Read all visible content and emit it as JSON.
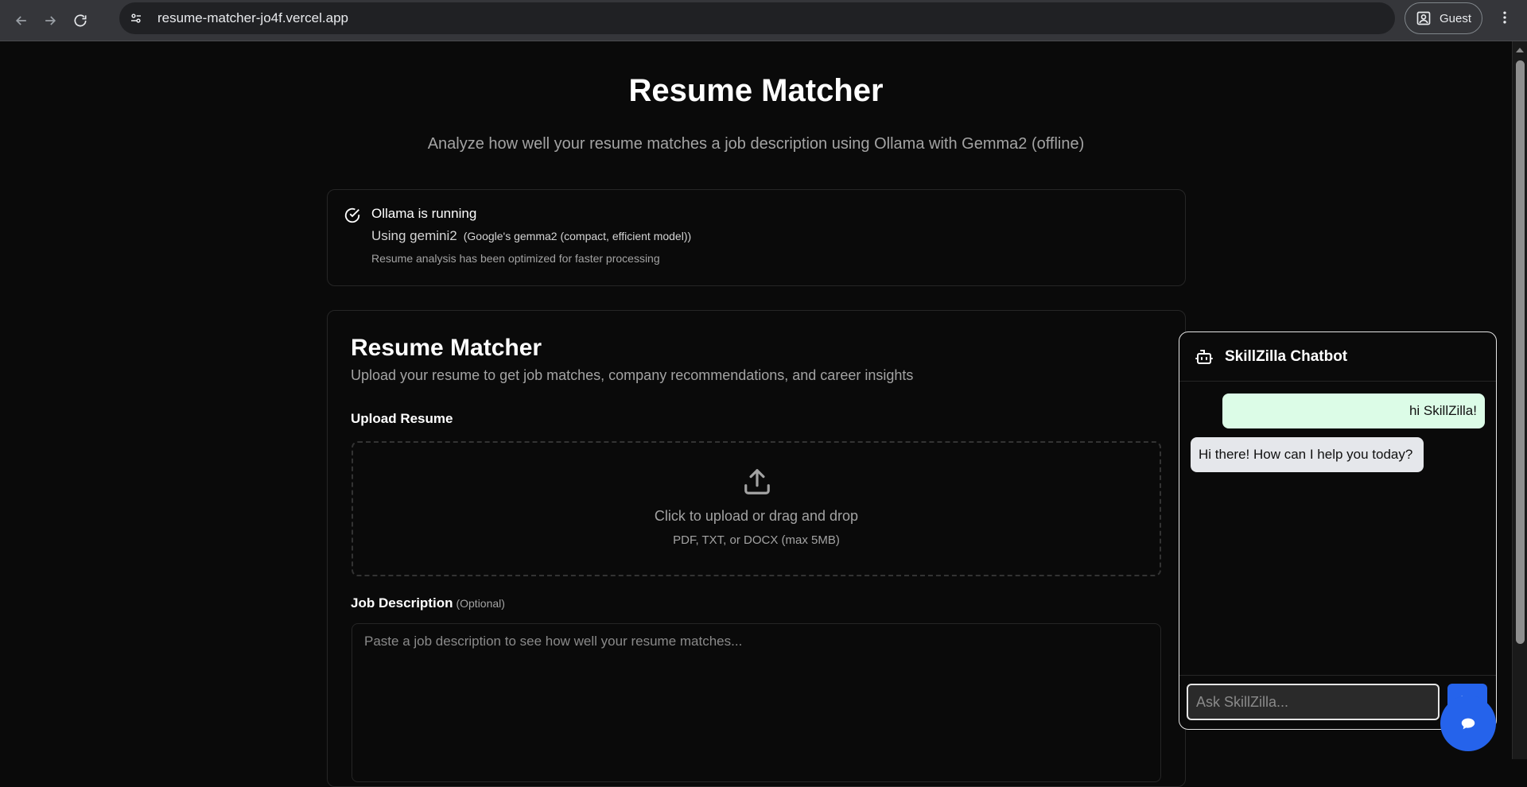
{
  "browser": {
    "url": "resume-matcher-jo4f.vercel.app",
    "profile_label": "Guest"
  },
  "page": {
    "title": "Resume Matcher",
    "subtitle": "Analyze how well your resume matches a job description using Ollama with Gemma2 (offline)"
  },
  "status": {
    "title": "Ollama is running",
    "model": "Using gemini2",
    "model_desc": "(Google's gemma2 (compact, efficient model))",
    "note": "Resume analysis has been optimized for faster processing"
  },
  "matcher": {
    "title": "Resume Matcher",
    "description": "Upload your resume to get job matches, company recommendations, and career insights",
    "upload_label": "Upload Resume",
    "dropzone_main": "Click to upload or drag and drop",
    "dropzone_sub": "PDF, TXT, or DOCX (max 5MB)",
    "jd_label": "Job Description",
    "jd_optional": "(Optional)",
    "jd_placeholder": "Paste a job description to see how well your resume matches..."
  },
  "chatbot": {
    "title": "SkillZilla Chatbot",
    "messages": [
      {
        "role": "user",
        "text": "hi SkillZilla!"
      },
      {
        "role": "bot",
        "text": "Hi there! How can I help you today?"
      }
    ],
    "input_placeholder": "Ask SkillZilla...",
    "colors": {
      "accent": "#2563eb",
      "user_bubble": "#dcfce7",
      "bot_bubble": "#e5e7eb"
    }
  }
}
